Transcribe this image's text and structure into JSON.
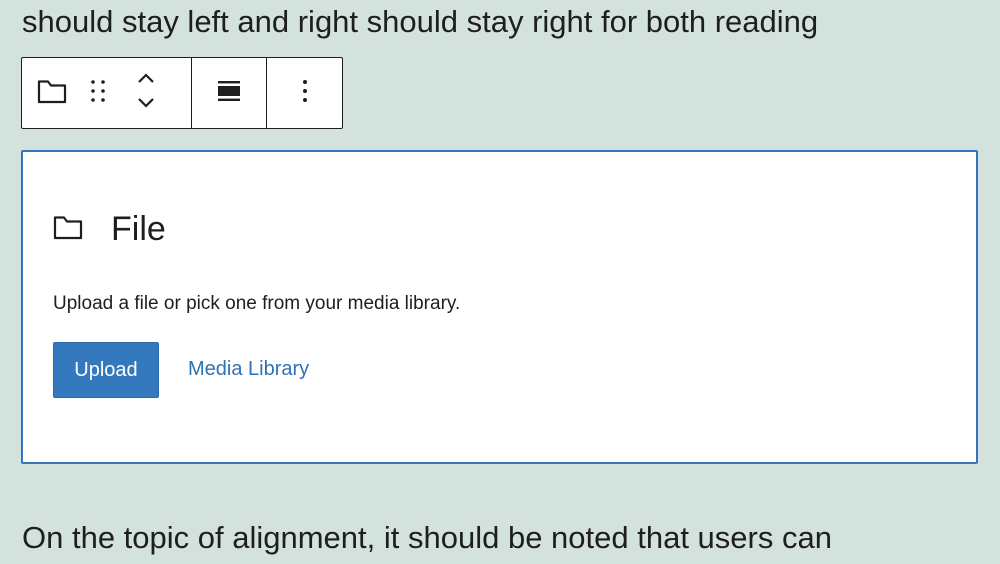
{
  "content": {
    "paragraph_above": "should stay left and right should stay right for both reading",
    "paragraph_below": "On the topic of alignment, it should be noted that users can"
  },
  "block_toolbar": {
    "icons": [
      "folder-icon",
      "drag-handle-icon",
      "chevron-up-icon",
      "chevron-down-icon",
      "align-icon",
      "more-options-icon"
    ]
  },
  "file_block": {
    "title": "File",
    "instructions": "Upload a file or pick one from your media library.",
    "upload_label": "Upload",
    "media_library_label": "Media Library"
  },
  "colors": {
    "page_background": "#d3e2dc",
    "accent": "#3478bd",
    "link": "#2e72b6",
    "text": "#1e1e1e"
  }
}
